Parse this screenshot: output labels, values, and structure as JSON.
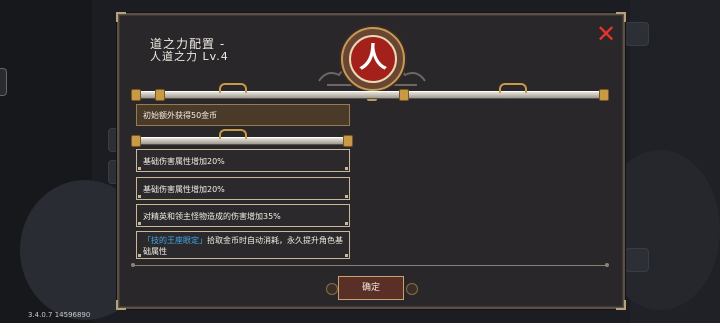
{
  "dialog": {
    "title_line1": "道之力配置 -",
    "title_line2": "人道之力 Lv.4",
    "emblem_char": "人",
    "close_label": "✕",
    "initial_bonus": "初始额外获得50金币",
    "effects": [
      "基础伤害属性增加20%",
      "基础伤害属性增加20%",
      "对精英和领主怪物造成的伤害增加35%"
    ],
    "special_effect": {
      "highlight": "「技的王座眼定」",
      "text": "拾取金币时自动消耗，永久提升角色基础属性"
    },
    "confirm_label": "确定"
  },
  "footer": {
    "version": "3.4.0.7 14596890"
  },
  "colors": {
    "close": "#e8322a",
    "emblem_red": "#a4201a",
    "highlight_blue": "#3fa8e8",
    "frame_gold": "#c9b99a"
  }
}
